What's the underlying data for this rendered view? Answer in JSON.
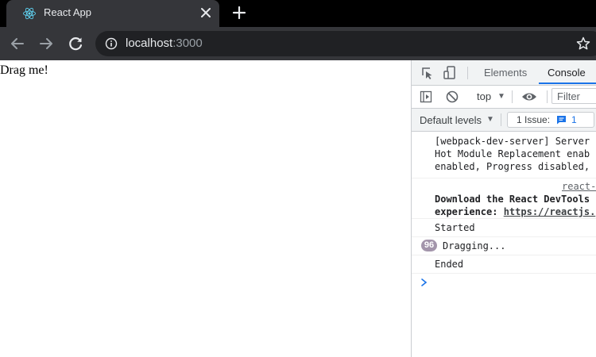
{
  "browser": {
    "tab": {
      "title": "React App"
    },
    "address": {
      "host": "localhost",
      "port": ":3000"
    }
  },
  "page": {
    "drag_text": "Drag me!"
  },
  "devtools": {
    "tabs": {
      "elements": "Elements",
      "console": "Console"
    },
    "toolbar": {
      "context": "top",
      "filter_placeholder": "Filter",
      "levels": "Default levels",
      "issues_label": "1 Issue:",
      "issues_count": "1"
    },
    "messages": {
      "webpack": [
        "[webpack-dev-server] Server",
        "Hot Module Replacement enab",
        "enabled, Progress disabled,"
      ],
      "source_link": "react-",
      "devtools_line1": "Download the React DevTools",
      "devtools_line2_prefix": "experience: ",
      "devtools_link": "https://reactjs.",
      "started": "Started",
      "dragging_count": "96",
      "dragging": "Dragging...",
      "ended": "Ended"
    }
  },
  "colors": {
    "accent": "#1a73e8",
    "tab_strip": "#000000",
    "toolbar": "#35363a",
    "react_logo": "#61dafb",
    "repeat_badge": "#a395ab"
  }
}
